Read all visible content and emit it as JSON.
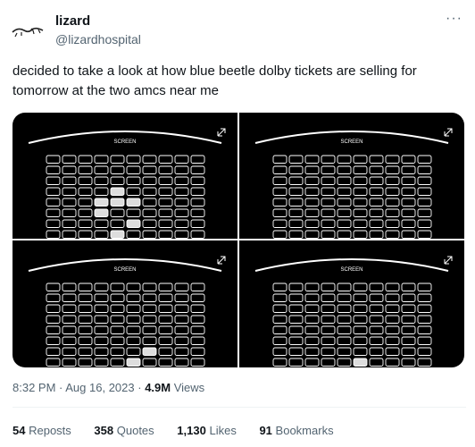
{
  "tweet": {
    "display_name": "lizard",
    "handle": "@lizardhospital",
    "more_icon": "more-icon",
    "text": "decided to take a look at how blue beetle dolby tickets are selling for tomorrow at the two amcs near me"
  },
  "seat_maps": [
    {
      "screen_label": "SCREEN",
      "rows": 8,
      "cols": 10,
      "sold": [
        [
          3,
          4
        ],
        [
          4,
          3
        ],
        [
          4,
          4
        ],
        [
          4,
          5
        ],
        [
          5,
          3
        ],
        [
          6,
          5
        ],
        [
          7,
          4
        ]
      ]
    },
    {
      "screen_label": "SCREEN",
      "rows": 8,
      "cols": 10,
      "sold": []
    },
    {
      "screen_label": "SCREEN",
      "rows": 8,
      "cols": 10,
      "sold": [
        [
          6,
          6
        ],
        [
          7,
          5
        ]
      ]
    },
    {
      "screen_label": "SCREEN",
      "rows": 8,
      "cols": 10,
      "sold": [
        [
          7,
          5
        ]
      ]
    }
  ],
  "meta": {
    "time": "8:32 PM",
    "date": "Aug 16, 2023",
    "views_count": "4.9M",
    "views_label": "Views"
  },
  "stats": {
    "reposts_count": "54",
    "reposts_label": "Reposts",
    "quotes_count": "358",
    "quotes_label": "Quotes",
    "likes_count": "1,130",
    "likes_label": "Likes",
    "bookmarks_count": "91",
    "bookmarks_label": "Bookmarks"
  }
}
